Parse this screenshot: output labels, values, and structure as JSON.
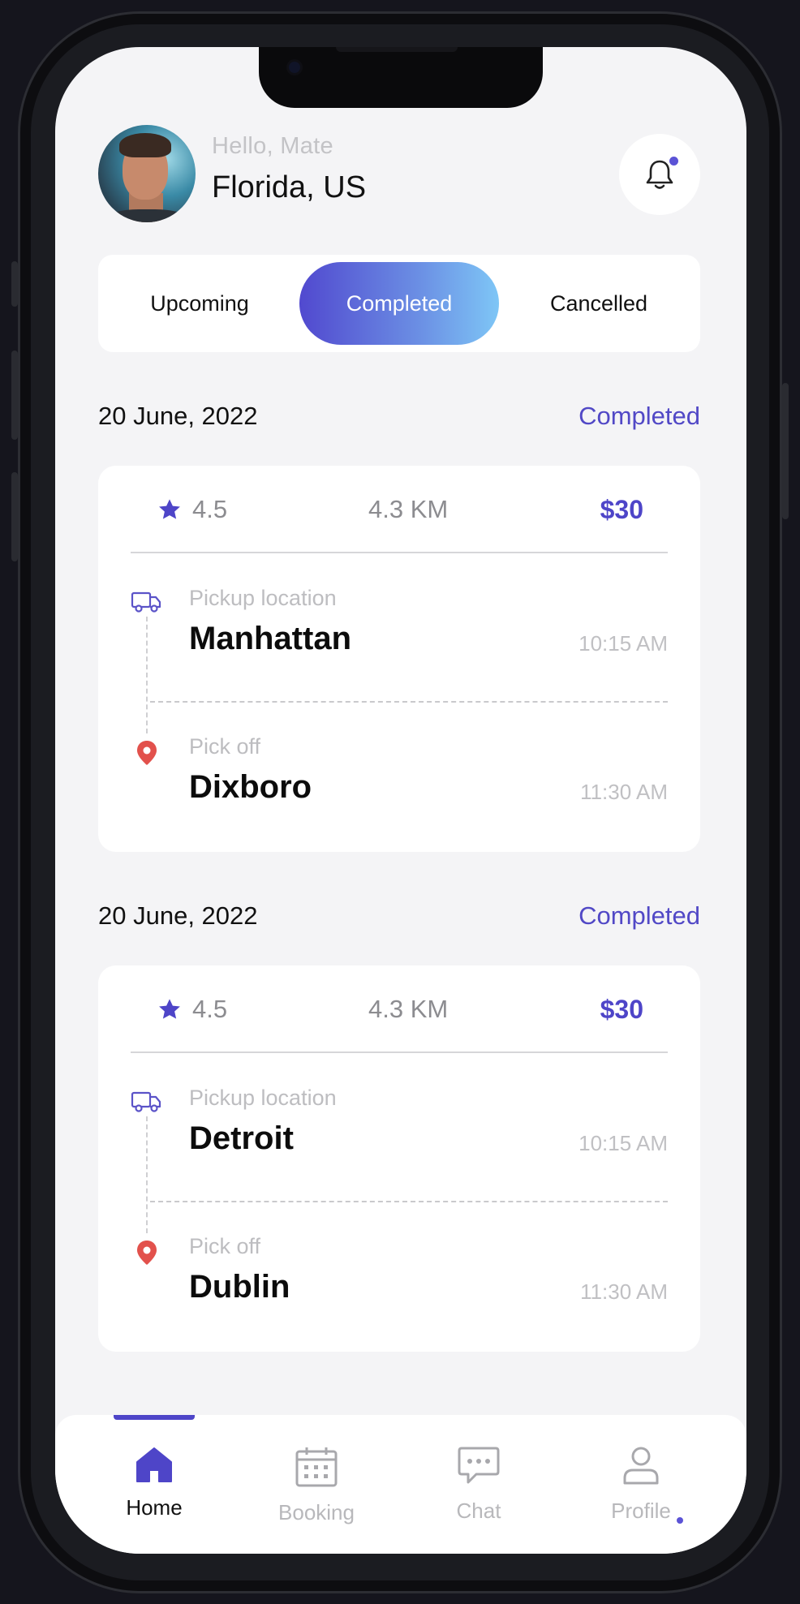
{
  "header": {
    "greeting": "Hello, Mate",
    "location": "Florida, US"
  },
  "tabs": {
    "items": [
      "Upcoming",
      "Completed",
      "Cancelled"
    ],
    "active": "Completed"
  },
  "rides": [
    {
      "date": "20 June, 2022",
      "status": "Completed",
      "rating": "4.5",
      "distance": "4.3 KM",
      "price": "$30",
      "pickup_label": "Pickup location",
      "pickup_place": "Manhattan",
      "pickup_time": "10:15 AM",
      "dropoff_label": "Pick off",
      "dropoff_place": "Dixboro",
      "dropoff_time": "11:30 AM"
    },
    {
      "date": "20 June, 2022",
      "status": "Completed",
      "rating": "4.5",
      "distance": "4.3 KM",
      "price": "$30",
      "pickup_label": "Pickup location",
      "pickup_place": "Detroit",
      "pickup_time": "10:15 AM",
      "dropoff_label": "Pick off",
      "dropoff_place": "Dublin",
      "dropoff_time": "11:30 AM"
    }
  ],
  "nav": {
    "items": [
      {
        "label": "Home",
        "icon": "home-icon",
        "active": true
      },
      {
        "label": "Booking",
        "icon": "calendar-icon",
        "active": false
      },
      {
        "label": "Chat",
        "icon": "chat-icon",
        "active": false
      },
      {
        "label": "Profile",
        "icon": "user-icon",
        "active": false
      }
    ]
  },
  "colors": {
    "accent": "#4e45c8",
    "gradient_start": "#5149cf",
    "gradient_end": "#7ec6f6",
    "pin": "#e2514c",
    "background": "#f4f4f6"
  }
}
